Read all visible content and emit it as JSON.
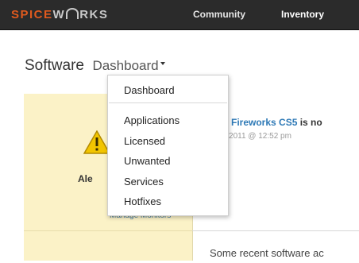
{
  "header": {
    "logo_primary": "SPICE",
    "logo_secondary": "W",
    "logo_tail": "RKS",
    "nav": [
      "Community",
      "Inventory"
    ]
  },
  "page": {
    "title": "Software",
    "dashboard_toggle": "Dashboard"
  },
  "dropdown": {
    "top_item": "Dashboard",
    "items": [
      "Applications",
      "Licensed",
      "Unwanted",
      "Services",
      "Hotfixes"
    ]
  },
  "alert_panel": {
    "label": "Ale",
    "manage_link": "Manage Monitors",
    "icon": "warning-icon",
    "background": "#fbf2c7"
  },
  "feed": {
    "item_link": "lobe Fireworks CS5",
    "item_suffix": " is no",
    "timestamp": "1 12, 2011 @ 12:52 pm"
  },
  "lower": {
    "text": "Some recent software ac"
  },
  "colors": {
    "topbar": "#2b2b2b",
    "logo_orange": "#e05a1e",
    "link_blue": "#2e79b6"
  }
}
